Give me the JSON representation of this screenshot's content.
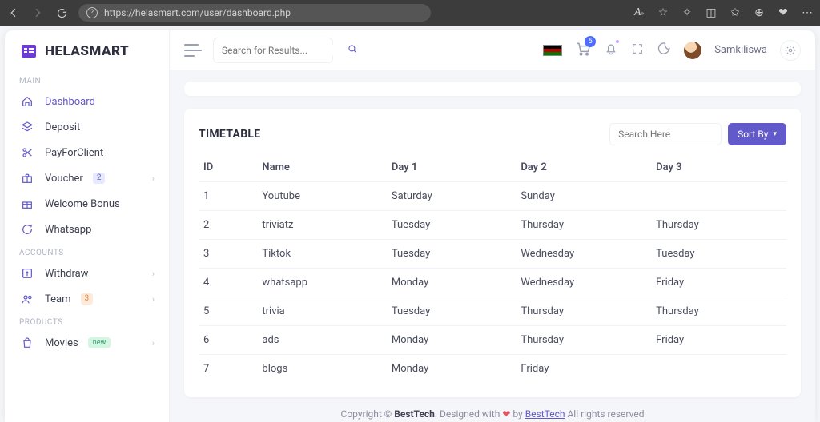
{
  "browser": {
    "url": "https://helasmart.com/user/dashboard.php"
  },
  "brand": "HELASMART",
  "header": {
    "search_placeholder": "Search for Results...",
    "cart_badge": "5",
    "user_name": "Samkiliswa"
  },
  "sidebar": {
    "sections": {
      "main": {
        "label": "MAIN"
      },
      "accounts": {
        "label": "ACCOUNTS"
      },
      "products": {
        "label": "PRODUCTS"
      }
    },
    "items": {
      "dashboard": {
        "label": "Dashboard"
      },
      "deposit": {
        "label": "Deposit"
      },
      "payforclient": {
        "label": "PayForClient"
      },
      "voucher": {
        "label": "Voucher",
        "badge": "2"
      },
      "welcome": {
        "label": "Welcome Bonus"
      },
      "whatsapp": {
        "label": "Whatsapp"
      },
      "withdraw": {
        "label": "Withdraw"
      },
      "team": {
        "label": "Team",
        "badge": "3"
      },
      "movies": {
        "label": "Movies",
        "badge": "new"
      }
    }
  },
  "timetable": {
    "title": "TIMETABLE",
    "search_placeholder": "Search Here",
    "sort_label": "Sort By",
    "columns": {
      "id": "ID",
      "name": "Name",
      "d1": "Day 1",
      "d2": "Day 2",
      "d3": "Day 3"
    },
    "rows": [
      {
        "id": "1",
        "name": "Youtube",
        "d1": "Saturday",
        "d2": "Sunday",
        "d3": ""
      },
      {
        "id": "2",
        "name": "triviatz",
        "d1": "Tuesday",
        "d2": "Thursday",
        "d3": "Thursday"
      },
      {
        "id": "3",
        "name": "Tiktok",
        "d1": "Tuesday",
        "d2": "Wednesday",
        "d3": "Tuesday"
      },
      {
        "id": "4",
        "name": "whatsapp",
        "d1": "Monday",
        "d2": "Wednesday",
        "d3": "Friday"
      },
      {
        "id": "5",
        "name": "trivia",
        "d1": "Tuesday",
        "d2": "Thursday",
        "d3": "Thursday"
      },
      {
        "id": "6",
        "name": "ads",
        "d1": "Monday",
        "d2": "Thursday",
        "d3": "Friday"
      },
      {
        "id": "7",
        "name": "blogs",
        "d1": "Monday",
        "d2": "Friday",
        "d3": ""
      }
    ]
  },
  "footer": {
    "copyright_prefix": "Copyright © ",
    "brand": "BestTech",
    "designed_prefix": ". Designed with ",
    "by": " by ",
    "link": "BestTech",
    "rights": " All rights reserved"
  }
}
